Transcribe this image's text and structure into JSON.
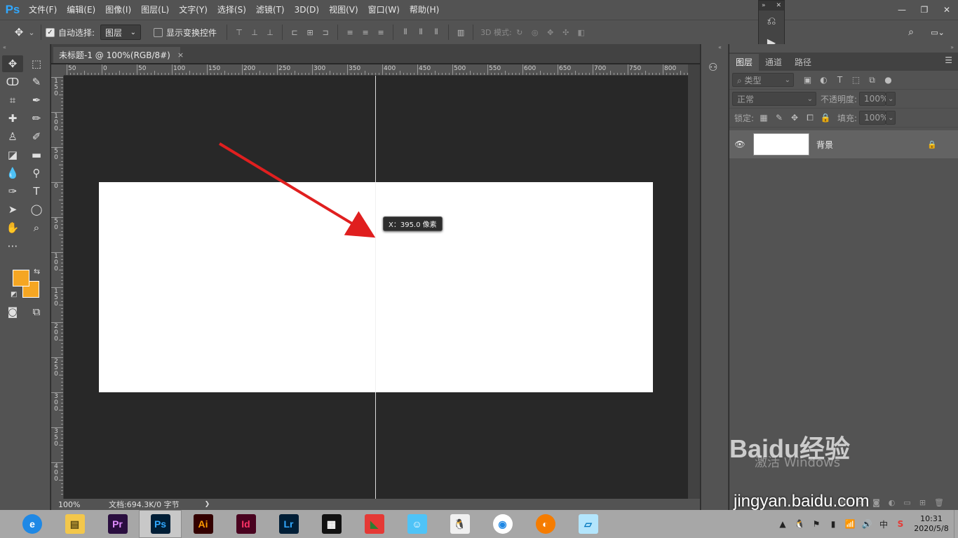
{
  "app": {
    "logo": "Ps"
  },
  "menu": [
    "文件(F)",
    "编辑(E)",
    "图像(I)",
    "图层(L)",
    "文字(Y)",
    "选择(S)",
    "滤镜(T)",
    "3D(D)",
    "视图(V)",
    "窗口(W)",
    "帮助(H)"
  ],
  "window_controls": {
    "minimize": "—",
    "restore": "❐",
    "close": "✕"
  },
  "options": {
    "auto_select_label": "自动选择:",
    "auto_select_checked": true,
    "auto_select_value": "图层",
    "show_transform_label": "显示变换控件",
    "show_transform_checked": false,
    "mode_3d_label": "3D 模式:"
  },
  "document": {
    "tab_title": "未标题-1 @ 100%(RGB/8#)",
    "tab_close": "×",
    "zoom": "100%",
    "doc_info": "文档:694.3K/0 字节",
    "status_arrow": "❯"
  },
  "ruler": {
    "top_labels": [
      "50",
      "0",
      "50",
      "100",
      "150",
      "200",
      "250",
      "300",
      "350",
      "400",
      "450",
      "500",
      "550",
      "600",
      "650",
      "700",
      "750",
      "800"
    ],
    "left_labels": [
      "1\n5\n0",
      "1\n0\n0",
      "5\n0",
      "0",
      "5\n0",
      "1\n0\n0",
      "1\n5\n0",
      "2\n0\n0",
      "2\n5\n0",
      "3\n0\n0",
      "3\n5\n0",
      "4\n0\n0"
    ]
  },
  "guide_tooltip": "X：395.0 像素",
  "colors": {
    "foreground": "#f5a623",
    "background": "#f5a623",
    "arrow": "#e01f1f"
  },
  "layers_panel": {
    "tabs": [
      "图层",
      "通道",
      "路径"
    ],
    "active_tab": 0,
    "filter_label": "⌕ 类型",
    "blend_mode": "正常",
    "opacity_label": "不透明度:",
    "opacity_value": "100%",
    "lock_label": "锁定:",
    "fill_label": "填充:",
    "fill_value": "100%",
    "layers": [
      {
        "name": "背景",
        "visible": true,
        "locked": true
      }
    ]
  },
  "watermark": {
    "activate_text": "激活 Windows",
    "baidu_logo": "Baidu经验",
    "baidu_url": "jingyan.baidu.com"
  },
  "taskbar": {
    "apps": [
      {
        "name": "browser",
        "label": "e",
        "color": "#1e88e5",
        "fg": "#ffffff"
      },
      {
        "name": "explorer",
        "label": "▤",
        "color": "#f3c74b",
        "fg": "#5b4a12"
      },
      {
        "name": "premiere",
        "label": "Pr",
        "color": "#2a0e3f",
        "fg": "#e08cff"
      },
      {
        "name": "photoshop",
        "label": "Ps",
        "color": "#001e36",
        "fg": "#31a8ff",
        "active": true
      },
      {
        "name": "illustrator",
        "label": "Ai",
        "color": "#330000",
        "fg": "#ff9a00"
      },
      {
        "name": "indesign",
        "label": "Id",
        "color": "#49021f",
        "fg": "#ff3366"
      },
      {
        "name": "lightroom",
        "label": "Lr",
        "color": "#001e36",
        "fg": "#31a8ff"
      },
      {
        "name": "video-editor",
        "label": "▦",
        "color": "#111111",
        "fg": "#ffffff"
      },
      {
        "name": "color-app",
        "label": "◣",
        "color": "#e53935",
        "fg": "#2e7d32"
      },
      {
        "name": "cat-app",
        "label": "☺",
        "color": "#4fc3f7",
        "fg": "#ffffff"
      },
      {
        "name": "qq",
        "label": "🐧",
        "color": "#f0f0f0",
        "fg": "#000000"
      },
      {
        "name": "chrome",
        "label": "◉",
        "color": "#ffffff",
        "fg": "#1e88e5"
      },
      {
        "name": "orange-app",
        "label": "◐",
        "color": "#f57c00",
        "fg": "#ffffff"
      },
      {
        "name": "notes-app",
        "label": "▱",
        "color": "#b3e5fc",
        "fg": "#0277bd"
      }
    ],
    "tray": {
      "ime": "中",
      "time": "10:31",
      "date": "2020/5/8"
    }
  }
}
